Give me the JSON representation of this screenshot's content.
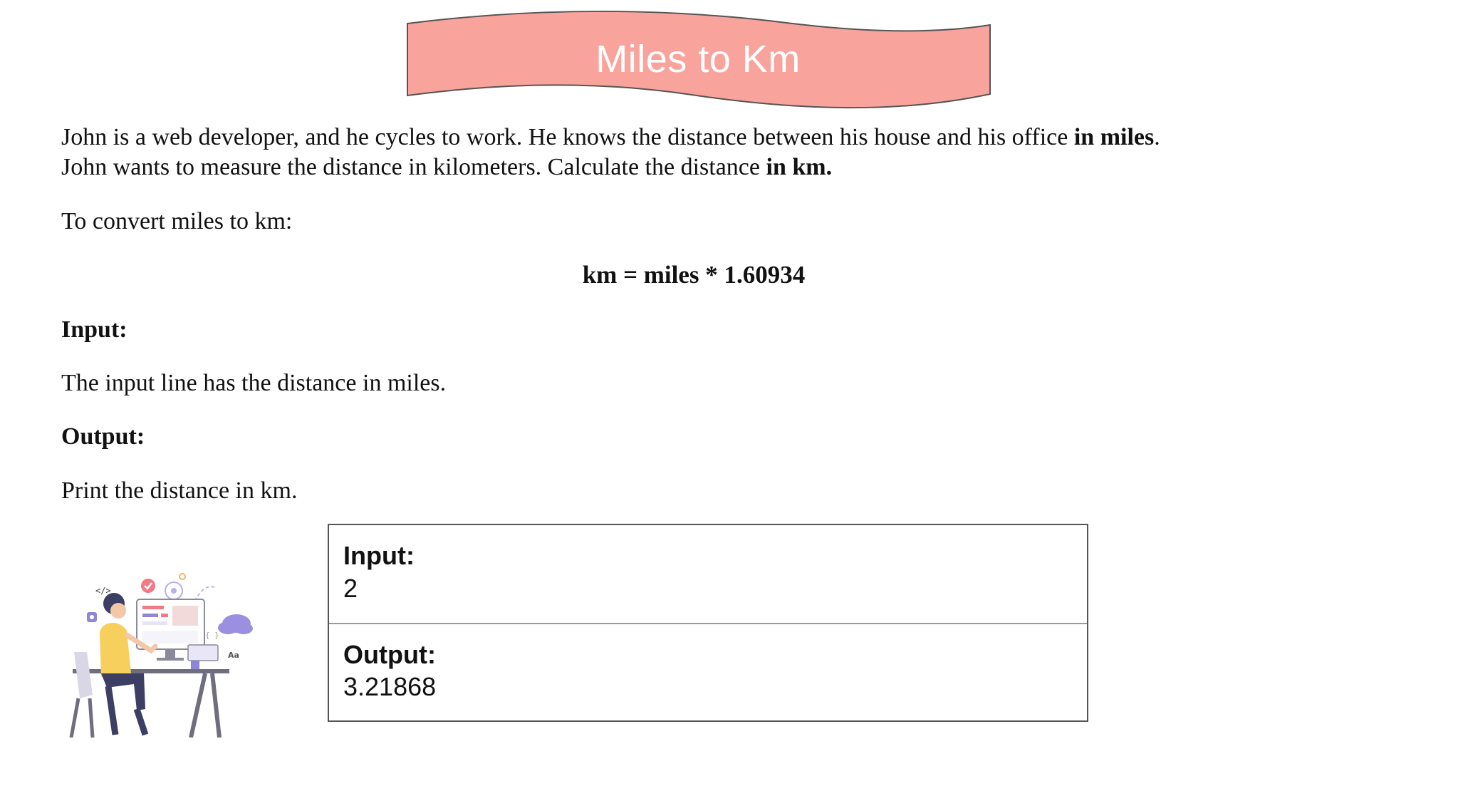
{
  "banner": {
    "title": "Miles to Km",
    "color": "#f8a39c"
  },
  "intro": {
    "line1_text": "John is a web developer, and he cycles to work. He knows the distance between his house and his office ",
    "line1_bold": "in miles",
    "line1_end": ".",
    "line2_text": "John wants to measure the distance in kilometers. Calculate the distance ",
    "line2_bold": "in km."
  },
  "conversion": {
    "label": "To convert miles to km:",
    "formula": "km = miles * 1.60934"
  },
  "input_section": {
    "heading": "Input:",
    "description": "The input line has the distance in miles."
  },
  "output_section": {
    "heading": "Output:",
    "description": "Print the distance in km."
  },
  "example": {
    "input_label": "Input:",
    "input_value": "2",
    "output_label": "Output:",
    "output_value": "3.21868"
  },
  "illustration": {
    "icon": "developer-at-desk-illustration",
    "code_tag": "</>",
    "font_tag": "Aa",
    "brace_tag": "{ }"
  }
}
